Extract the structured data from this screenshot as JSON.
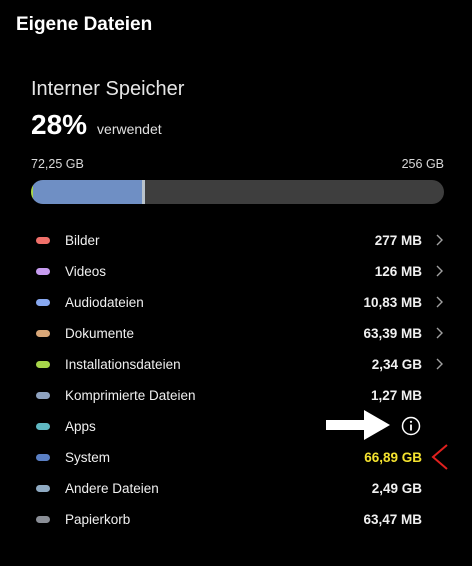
{
  "header": {
    "title": "Eigene Dateien"
  },
  "storage": {
    "title": "Interner Speicher",
    "percent": "28%",
    "percent_label": "verwendet",
    "used": "72,25 GB",
    "total": "256 GB",
    "used_fraction": 0.28,
    "segments": [
      {
        "category": "Installationsdateien",
        "fraction": 0.004,
        "color": "#a7d54a"
      },
      {
        "category": "Andere",
        "fraction": 0.265,
        "color": "#6f8fc4"
      }
    ]
  },
  "categories": [
    {
      "label": "Bilder",
      "value": "277 MB",
      "color": "#f0706a",
      "chevron": true,
      "highlight": false
    },
    {
      "label": "Videos",
      "value": "126 MB",
      "color": "#c79cf0",
      "chevron": true,
      "highlight": false
    },
    {
      "label": "Audiodateien",
      "value": "10,83 MB",
      "color": "#88a8f0",
      "chevron": true,
      "highlight": false
    },
    {
      "label": "Dokumente",
      "value": "63,39 MB",
      "color": "#d9a778",
      "chevron": true,
      "highlight": false
    },
    {
      "label": "Installationsdateien",
      "value": "2,34 GB",
      "color": "#a7d54a",
      "chevron": true,
      "highlight": false
    },
    {
      "label": "Komprimierte Dateien",
      "value": "1,27 MB",
      "color": "#8ea2bf",
      "chevron": false,
      "highlight": false
    },
    {
      "label": "Apps",
      "value": "",
      "color": "#5fb8c2",
      "chevron": false,
      "highlight": false
    },
    {
      "label": "System",
      "value": "66,89 GB",
      "color": "#5a7fc4",
      "chevron": false,
      "highlight": true
    },
    {
      "label": "Andere Dateien",
      "value": "2,49 GB",
      "color": "#8faac2",
      "chevron": false,
      "highlight": false
    },
    {
      "label": "Papierkorb",
      "value": "63,47 MB",
      "color": "#8a8e96",
      "chevron": false,
      "highlight": false
    }
  ],
  "icons": {
    "chevron": "chevron-right-icon",
    "info": "info-icon",
    "annotation_arrow": "arrow-right-icon",
    "annotation_mark": "red-chevron-icon"
  },
  "colors": {
    "highlight": "#f4e22f",
    "annotation": "#e0201e",
    "bar_track": "#3e3e3e"
  }
}
